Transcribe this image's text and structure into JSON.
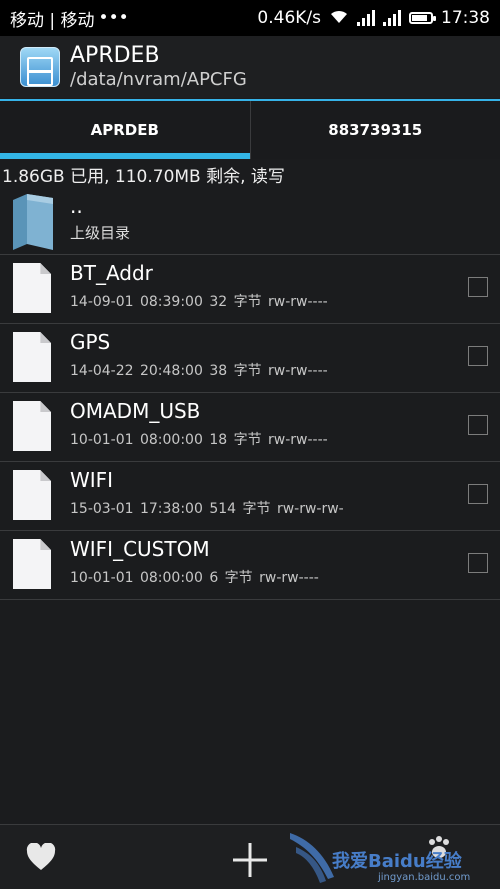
{
  "status_bar": {
    "carrier": "移动 | 移动",
    "dots": "•••",
    "speed": "0.46K/s",
    "time": "17:38",
    "battery_level": 0.85
  },
  "header": {
    "title": "APRDEB",
    "path": "/data/nvram/APCFG",
    "icon": "file-manager-icon"
  },
  "tabs": [
    {
      "label": "APRDEB",
      "active": true
    },
    {
      "label": "883739315",
      "active": false
    }
  ],
  "storage_info": "1.86GB 已用, 110.70MB 剩余, 读写",
  "parent_dir": {
    "name": "..",
    "label": "上级目录",
    "icon": "folder-icon"
  },
  "files": [
    {
      "name": "BT_Addr",
      "meta": "14-09-01 08:39:00  32 字节  rw-rw----",
      "checked": false
    },
    {
      "name": "GPS",
      "meta": "14-04-22 20:48:00  38 字节  rw-rw----",
      "checked": false
    },
    {
      "name": "OMADM_USB",
      "meta": "10-01-01 08:00:00  18 字节  rw-rw----",
      "checked": false
    },
    {
      "name": "WIFI",
      "meta": "15-03-01 17:38:00  514 字节  rw-rw-rw-",
      "checked": false
    },
    {
      "name": "WIFI_CUSTOM",
      "meta": "10-01-01 08:00:00  6 字节  rw-rw----",
      "checked": false
    }
  ],
  "bottom_bar": {
    "favorite_icon": "heart-icon",
    "add_icon": "plus-icon"
  },
  "watermark": {
    "text": "我爱Baidu经验",
    "url": "jingyan.baidu.com"
  },
  "colors": {
    "accent": "#33b5e5",
    "background": "#1b1c1e"
  }
}
